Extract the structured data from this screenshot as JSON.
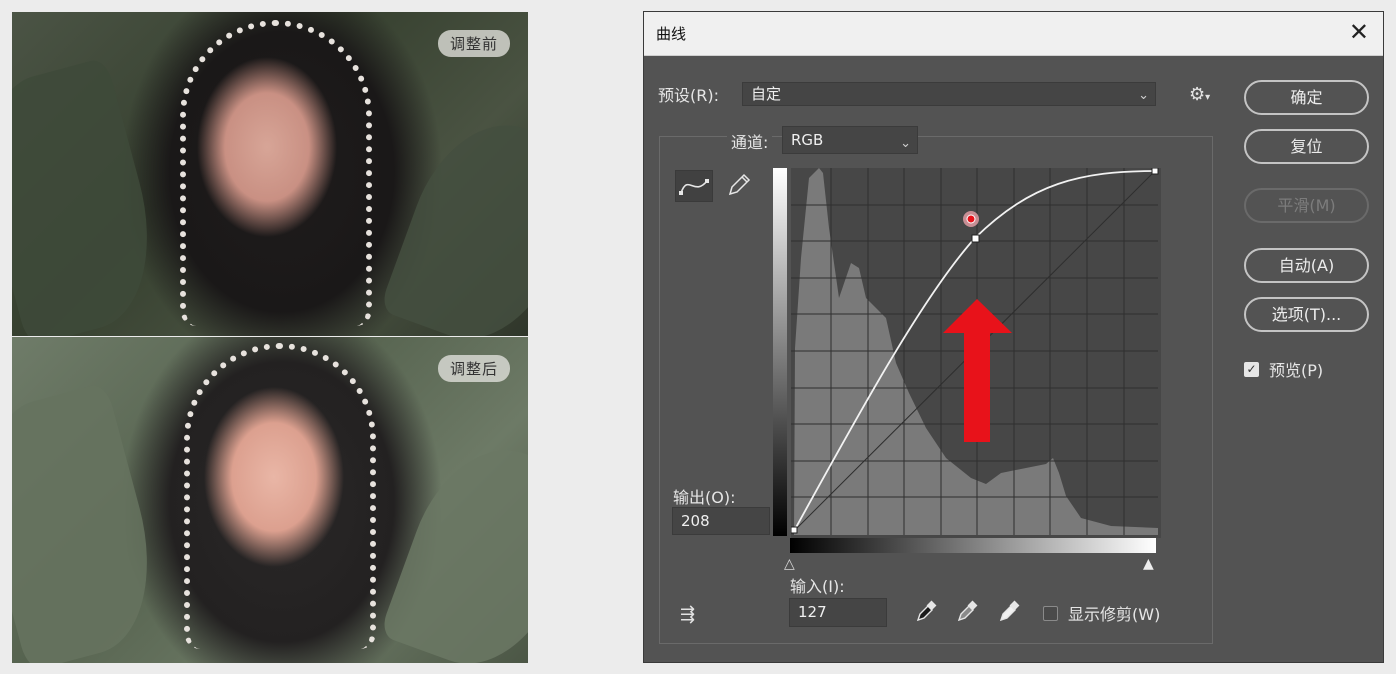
{
  "photos": {
    "before_label": "调整前",
    "after_label": "调整后"
  },
  "dialog": {
    "title": "曲线",
    "close_icon": "close-icon",
    "preset_label": "预设(R):",
    "preset_value": "自定",
    "channel_label": "通道:",
    "channel_value": "RGB",
    "output_label": "输出(O):",
    "output_value": "208",
    "input_label": "输入(I):",
    "input_value": "127",
    "show_clipping_label": "显示修剪(W)",
    "show_clipping_checked": false,
    "buttons": {
      "ok": "确定",
      "reset": "复位",
      "smooth": "平滑(M)",
      "auto": "自动(A)",
      "options": "选项(T)..."
    },
    "preview_label": "预览(P)",
    "preview_checked": true,
    "colors": {
      "dialog_bg": "#535353",
      "graph_bg": "#474747",
      "histogram": "#7a7a7a",
      "curve": "#f2f2f2",
      "arrow": "#e8121a"
    }
  }
}
